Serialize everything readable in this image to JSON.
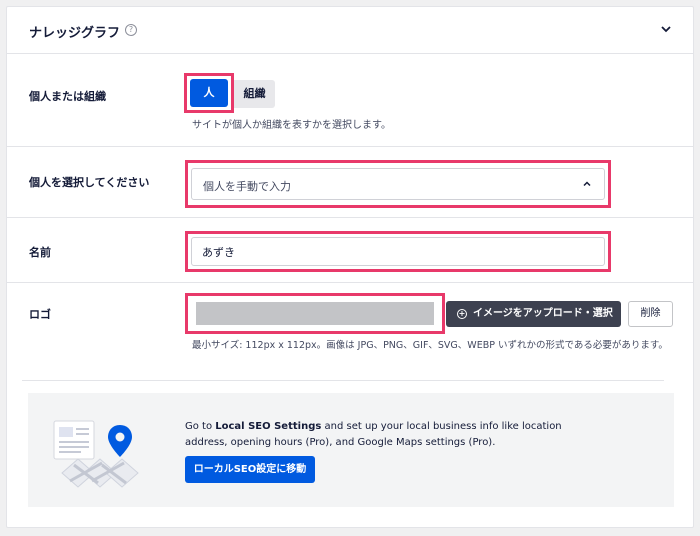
{
  "header": {
    "title": "ナレッジグラフ",
    "help_icon": "question-circle-icon",
    "toggle_icon": "chevron-down-icon"
  },
  "person_or_org": {
    "label": "個人または組織",
    "options": [
      "人",
      "組織"
    ],
    "selected": "人",
    "helper": "サイトが個人か組織を表すかを選択します。"
  },
  "select_person": {
    "label": "個人を選択してください",
    "value": "個人を手動で入力"
  },
  "name": {
    "label": "名前",
    "value": "あずき"
  },
  "logo": {
    "label": "ロゴ",
    "upload_label": "イメージをアップロード・選択",
    "delete_label": "削除",
    "helper": "最小サイズ: 112px x 112px。画像は JPG、PNG、GIF、SVG、WEBP いずれかの形式である必要があります。"
  },
  "local_seo": {
    "text_prefix": "Go to ",
    "text_bold": "Local SEO Settings",
    "text_suffix": " and set up your local business info like location address, opening hours (Pro), and Google Maps settings (Pro).",
    "button_label": "ローカルSEO設定に移動"
  },
  "colors": {
    "accent": "#005ae0",
    "highlight": "#e8396a",
    "dark_button": "#3d4150"
  }
}
